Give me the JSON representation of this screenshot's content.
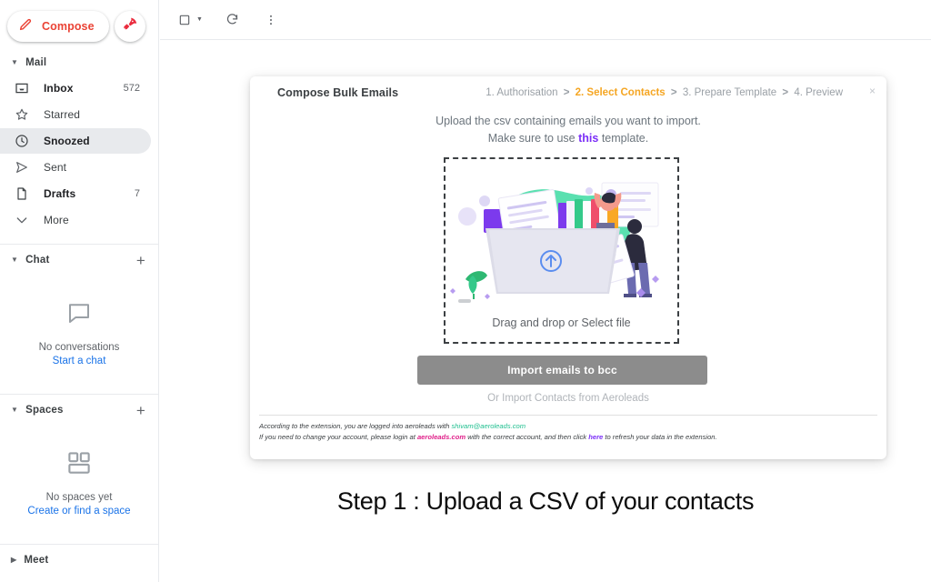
{
  "sidebar": {
    "compose": {
      "label": "Compose",
      "icon": "pencil-icon"
    },
    "rocket": {
      "icon": "rocket-icon"
    },
    "mail": {
      "title": "Mail",
      "items": [
        {
          "label": "Inbox",
          "count": "572",
          "icon": "inbox-icon",
          "active": false,
          "bold": true
        },
        {
          "label": "Starred",
          "count": "",
          "icon": "star-icon",
          "active": false,
          "bold": false
        },
        {
          "label": "Snoozed",
          "count": "",
          "icon": "clock-icon",
          "active": true,
          "bold": true
        },
        {
          "label": "Sent",
          "count": "",
          "icon": "send-icon",
          "active": false,
          "bold": false
        },
        {
          "label": "Drafts",
          "count": "7",
          "icon": "draft-icon",
          "active": false,
          "bold": true
        },
        {
          "label": "More",
          "count": "",
          "icon": "chevron-down-icon",
          "active": false,
          "bold": false
        }
      ]
    },
    "chat": {
      "title": "Chat",
      "add_icon": "plus-icon",
      "empty_title": "No conversations",
      "empty_link": "Start a chat",
      "empty_icon": "chat-bubble-icon"
    },
    "spaces": {
      "title": "Spaces",
      "add_icon": "plus-icon",
      "empty_title": "No spaces yet",
      "empty_link": "Create or find a space",
      "empty_icon": "spaces-grid-icon"
    },
    "meet": {
      "title": "Meet"
    }
  },
  "toolbar": {
    "select_all": "select-all-checkbox",
    "select_caret": "chevron-down-icon",
    "refresh": "refresh-icon",
    "more": "more-vertical-icon"
  },
  "modal": {
    "title": "Compose Bulk Emails",
    "close_label": "×",
    "steps": [
      {
        "label": "1. Authorisation",
        "active": false
      },
      {
        "label": "2. Select Contacts",
        "active": true
      },
      {
        "label": "3. Prepare Template",
        "active": false
      },
      {
        "label": "4. Preview",
        "active": false
      }
    ],
    "step_separator": ">",
    "active_step_color": "#f5a623",
    "instruction_line1": "Upload the csv containing emails you want to import.",
    "instruction_line2_before": "Make sure to use ",
    "instruction_link": "this",
    "instruction_line2_after": " template.",
    "dropzone_label": "Drag and drop or Select file",
    "dropzone_icon": "upload-arrow-icon",
    "import_button": "Import emails to bcc",
    "import_alt": "Or Import Contacts from Aeroleads",
    "footer": {
      "line1_before": "According to the extension, you are logged into aeroleads with ",
      "line1_email": "shivam@aeroleads.com",
      "line2_before": "If you need to change your account, please login at ",
      "line2_site": "aeroleads.com",
      "line2_mid": " with the correct account, and then click ",
      "line2_link": "here",
      "line2_after": " to refresh your data in the extension."
    }
  },
  "caption": {
    "text": "Step 1 : Upload a CSV of your contacts"
  }
}
